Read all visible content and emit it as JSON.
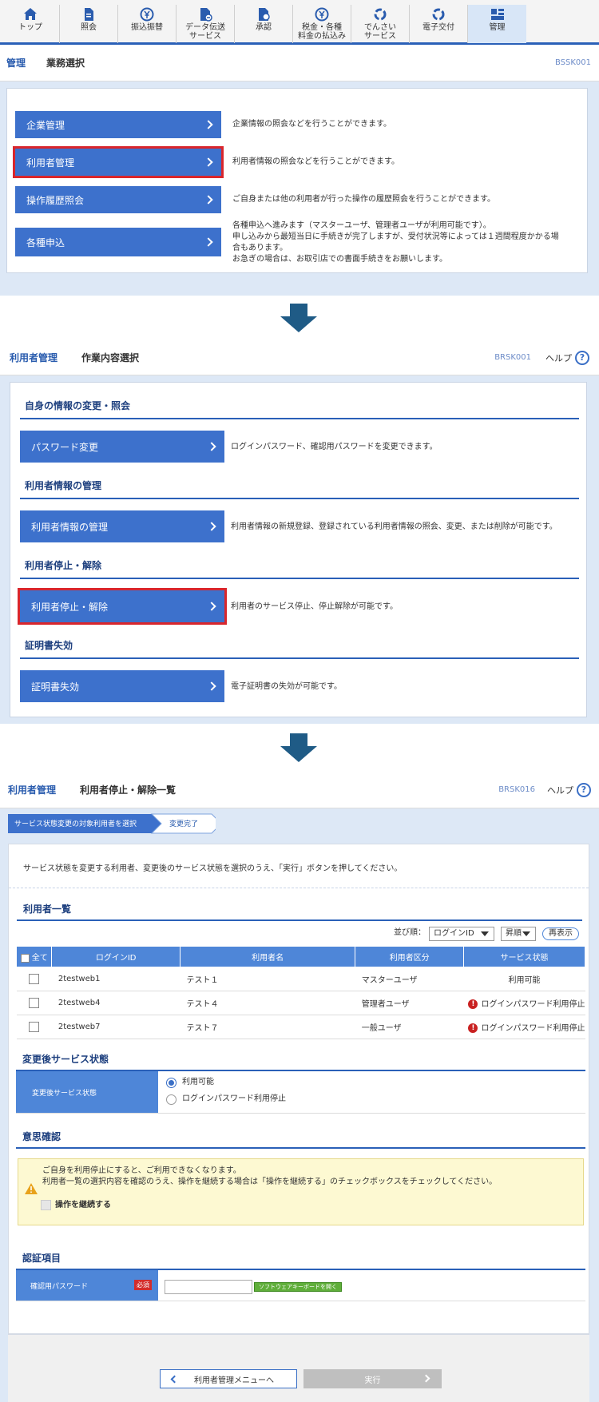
{
  "nav": {
    "items": [
      {
        "label": "トップ",
        "icon": "home-icon"
      },
      {
        "label": "照会",
        "icon": "document-icon"
      },
      {
        "label": "振込振替",
        "icon": "yen-coin-icon"
      },
      {
        "label": "データ伝送\nサービス",
        "icon": "data-transfer-icon"
      },
      {
        "label": "承認",
        "icon": "approval-icon"
      },
      {
        "label": "税金・各種\n料金の払込み",
        "icon": "yen-coin-icon"
      },
      {
        "label": "でんさい\nサービス",
        "icon": "circular-arrows-icon"
      },
      {
        "label": "電子交付",
        "icon": "circular-arrows-icon"
      },
      {
        "label": "管理",
        "icon": "management-icon"
      }
    ]
  },
  "screen1": {
    "breadcrumb_root": "管理",
    "title": "業務選択",
    "code": "BSSK001",
    "menu": [
      {
        "label": "企業管理",
        "desc": [
          "企業情報の照会などを行うことができます。"
        ]
      },
      {
        "label": "利用者管理",
        "desc": [
          "利用者情報の照会などを行うことができます。"
        ]
      },
      {
        "label": "操作履歴照会",
        "desc": [
          "ご自身または他の利用者が行った操作の履歴照会を行うことができます。"
        ]
      },
      {
        "label": "各種申込",
        "desc": [
          "各種申込へ進みます（マスターユーザ、管理者ユーザが利用可能です）。",
          "申し込みから最短当日に手続きが完了しますが、受付状況等によっては１週間程度かかる場",
          "合もあります。",
          "お急ぎの場合は、お取引店での書面手続きをお願いします。"
        ]
      }
    ]
  },
  "screen2": {
    "breadcrumb_root": "利用者管理",
    "title": "作業内容選択",
    "code": "BRSK001",
    "help": "ヘルプ",
    "sections": [
      {
        "title": "自身の情報の変更・照会",
        "button": "パスワード変更",
        "desc": "ログインパスワード、確認用パスワードを変更できます。"
      },
      {
        "title": "利用者情報の管理",
        "button": "利用者情報の管理",
        "desc": "利用者情報の新規登録、登録されている利用者情報の照会、変更、または削除が可能です。"
      },
      {
        "title": "利用者停止・解除",
        "button": "利用者停止・解除",
        "desc": "利用者のサービス停止、停止解除が可能です。"
      },
      {
        "title": "証明書失効",
        "button": "証明書失効",
        "desc": "電子証明書の失効が可能です。"
      }
    ]
  },
  "screen3": {
    "breadcrumb_root": "利用者管理",
    "title": "利用者停止・解除一覧",
    "code": "BRSK016",
    "help": "ヘルプ",
    "steps": [
      "サービス状態変更の対象利用者を選択",
      "変更完了"
    ],
    "instruction": "サービス状態を変更する利用者、変更後のサービス状態を選択のうえ、「実行」ボタンを押してください。",
    "user_list_title": "利用者一覧",
    "sort_label": "並び順：",
    "sort_key": "ログインID",
    "sort_order": "昇順",
    "redisplay": "再表示",
    "columns": [
      "全て",
      "ログインID",
      "利用者名",
      "利用者区分",
      "サービス状態"
    ],
    "rows": [
      {
        "id": "2testweb1",
        "name": "テスト１",
        "type": "マスターユーザ",
        "status": "利用可能",
        "warn": false
      },
      {
        "id": "2testweb4",
        "name": "テスト４",
        "type": "管理者ユーザ",
        "status": "ログインパスワード利用停止",
        "warn": true
      },
      {
        "id": "2testweb7",
        "name": "テスト７",
        "type": "一般ユーザ",
        "status": "ログインパスワード利用停止",
        "warn": true
      }
    ],
    "status_title": "変更後サービス状態",
    "status_label": "変更後サービス状態",
    "status_options": [
      "利用可能",
      "ログインパスワード利用停止"
    ],
    "confirm_title": "意思確認",
    "warning_lines": [
      "ご自身を利用停止にすると、ご利用できなくなります。",
      "利用者一覧の選択内容を確認のうえ、操作を継続する場合は「操作を継続する」のチェックボックスをチェックしてください。"
    ],
    "continue_label": "操作を継続する",
    "auth_title": "認証項目",
    "password_label": "確認用パスワード",
    "required_badge": "必須",
    "keyboard_button": "ソフトウェアキーボードを開く",
    "back_button": "利用者管理メニューへ",
    "execute_button": "実行"
  },
  "colors": {
    "accent": "#2a60b8",
    "button": "#3d71cc",
    "selected_outline": "#d9262c",
    "warning_bg": "#fdf9d2"
  }
}
